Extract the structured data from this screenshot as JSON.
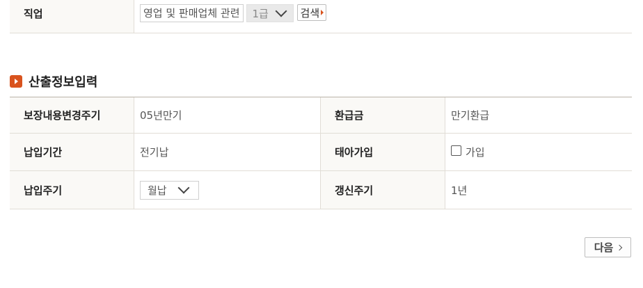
{
  "job": {
    "label": "직업",
    "value": "영업 및 판매업체 관련",
    "grade": "1급",
    "search_label": "검색"
  },
  "section": {
    "title": "산출정보입력"
  },
  "info": {
    "row1": {
      "label_left": "보장내용변경주기",
      "value_left": "05년만기",
      "label_right": "환급금",
      "value_right": "만기환급"
    },
    "row2": {
      "label_left": "납입기간",
      "value_left": "전기납",
      "label_right": "태아가입",
      "checkbox_label": "가입"
    },
    "row3": {
      "label_left": "납입주기",
      "select_value": "월납",
      "label_right": "갱신주기",
      "value_right": "1년"
    }
  },
  "next_label": "다음",
  "colors": {
    "accent": "#d9531e",
    "header_bg": "#faf9f6",
    "border": "#e1ddd6"
  }
}
